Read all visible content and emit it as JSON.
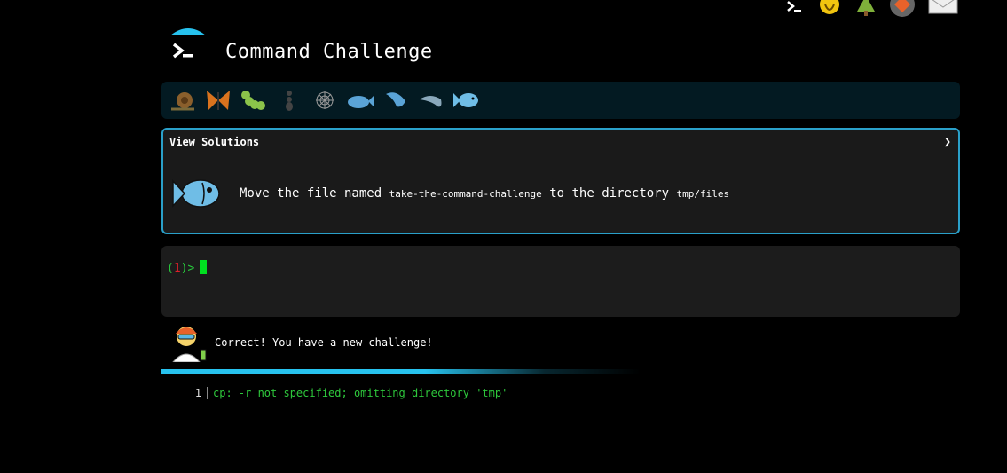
{
  "header": {
    "title": "Command Challenge"
  },
  "top_icons": [
    "terminal-icon",
    "lightbulb-hand-icon",
    "tree-icon",
    "fox-icon",
    "envelope-icon"
  ],
  "levels": [
    {
      "icon": "snail-icon"
    },
    {
      "icon": "butterfly-icon"
    },
    {
      "icon": "caterpillar-icon"
    },
    {
      "icon": "ant-icon"
    },
    {
      "icon": "spiderweb-icon"
    },
    {
      "icon": "whale-icon"
    },
    {
      "icon": "dolphin-icon"
    },
    {
      "icon": "dolphin-2-icon"
    },
    {
      "icon": "fish-icon"
    }
  ],
  "panel": {
    "header_label": "View Solutions",
    "chevron": "❯",
    "challenge": {
      "prefix": "Move the file named",
      "file": "take-the-command-challenge",
      "middle": "to the directory",
      "dir": "tmp/files"
    }
  },
  "terminal": {
    "prompt_open": "(",
    "prompt_num": "1",
    "prompt_close": ")>"
  },
  "feedback": {
    "message": "Correct! You have a new challenge!"
  },
  "output": [
    {
      "num": "1",
      "text": "cp: -r not specified; omitting directory 'tmp'"
    }
  ],
  "colors": {
    "accent": "#2aa0c9",
    "progress": "#27c2ee",
    "prompt_green": "#28c83c",
    "prompt_red": "#e0202a",
    "cursor": "#00e020"
  }
}
